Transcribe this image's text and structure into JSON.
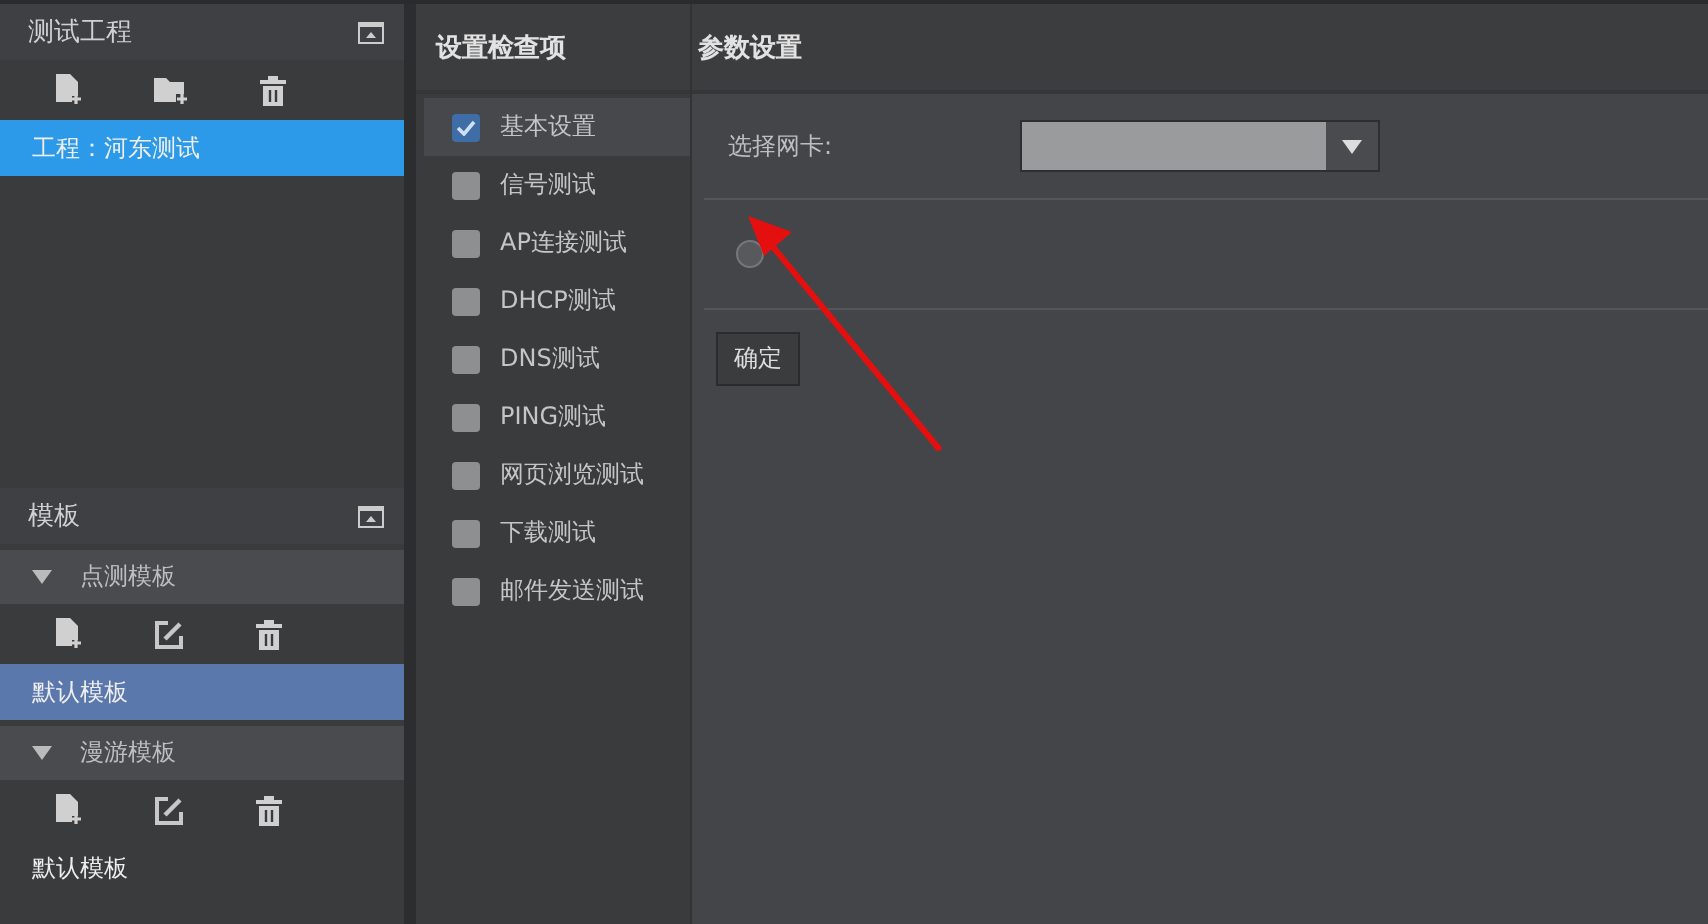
{
  "project_panel": {
    "title": "测试工程",
    "items": [
      {
        "label": "工程：河东测试",
        "selected": true
      }
    ]
  },
  "template_panel": {
    "title": "模板",
    "groups": [
      {
        "title": "点测模板",
        "expanded": true,
        "items": [
          {
            "label": "默认模板",
            "selected": true
          }
        ]
      },
      {
        "title": "漫游模板",
        "expanded": true,
        "items": [
          {
            "label": "默认模板",
            "selected": false
          }
        ]
      }
    ]
  },
  "check_panel": {
    "title": "设置检查项",
    "items": [
      {
        "label": "基本设置",
        "checked": true,
        "selected": true
      },
      {
        "label": "信号测试",
        "checked": false,
        "selected": false
      },
      {
        "label": "AP连接测试",
        "checked": false,
        "selected": false
      },
      {
        "label": "DHCP测试",
        "checked": false,
        "selected": false
      },
      {
        "label": "DNS测试",
        "checked": false,
        "selected": false
      },
      {
        "label": "PING测试",
        "checked": false,
        "selected": false
      },
      {
        "label": "网页浏览测试",
        "checked": false,
        "selected": false
      },
      {
        "label": "下载测试",
        "checked": false,
        "selected": false
      },
      {
        "label": "邮件发送测试",
        "checked": false,
        "selected": false
      }
    ]
  },
  "params_panel": {
    "title": "参数设置",
    "nic_label": "选择网卡:",
    "radio": {
      "selected": false
    },
    "confirm_button": "确定"
  }
}
